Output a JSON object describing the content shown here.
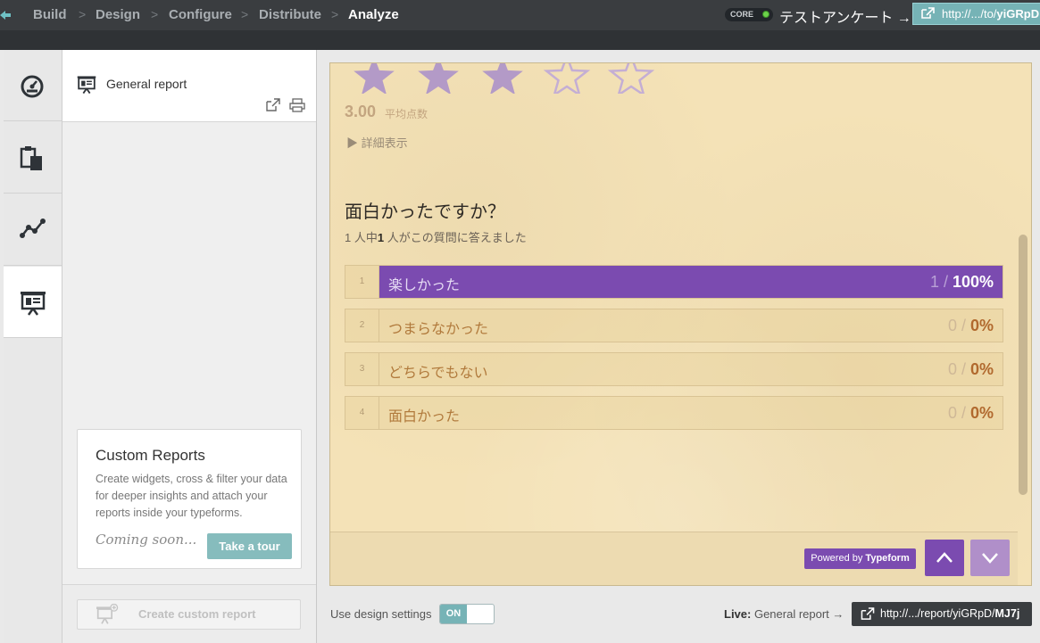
{
  "breadcrumbs": [
    {
      "label": "Build"
    },
    {
      "label": "Design"
    },
    {
      "label": "Configure"
    },
    {
      "label": "Distribute"
    },
    {
      "label": "Analyze",
      "active": true
    }
  ],
  "topbar": {
    "plan_badge": "CORE",
    "form_title": "テストアンケート →",
    "share_url_prefix": "http://.../to/",
    "share_url_code": "yiGRpD"
  },
  "sidebar_icons": [
    {
      "icon": "dashboard-gauge-icon"
    },
    {
      "icon": "clipboard-copy-icon"
    },
    {
      "icon": "line-chart-icon"
    },
    {
      "icon": "presentation-report-icon",
      "active": true
    }
  ],
  "reports_panel": {
    "report_title": "General report",
    "custom_reports": {
      "heading": "Custom Reports",
      "description": "Create widgets, cross & filter your data for deeper insights and attach your reports inside your typeforms.",
      "coming_soon": "Coming soon...",
      "tour_button": "Take a tour"
    },
    "create_button": "Create custom report"
  },
  "preview": {
    "rating": {
      "stars_total": 5,
      "stars_filled": 3,
      "average": "3.00",
      "average_label": "平均点数"
    },
    "details_toggle": "▶ 詳細表示",
    "question": "面白かったですか？",
    "answered": {
      "prefix": "1 人中",
      "count": "1",
      "suffix": " 人がこの質問に答えました"
    },
    "choices": [
      {
        "num": "1",
        "label": "楽しかった",
        "count": "1 / ",
        "percent": "100%",
        "fraction": 1.0
      },
      {
        "num": "2",
        "label": "つまらなかった",
        "count": "0 / ",
        "percent": "0%",
        "fraction": 0
      },
      {
        "num": "3",
        "label": "どちらでもない",
        "count": "0 / ",
        "percent": "0%",
        "fraction": 0
      },
      {
        "num": "4",
        "label": "面白かった",
        "count": "0 / ",
        "percent": "0%",
        "fraction": 0
      }
    ],
    "powered_prefix": "Powered by ",
    "powered_brand": "Typeform"
  },
  "bottom": {
    "use_design_label": "Use design settings",
    "toggle_label": "ON",
    "live_label": "Live:",
    "live_report": "General report →",
    "live_url_prefix": "http://.../report/yiGRpD/",
    "live_url_code": "MJ7j"
  },
  "colors": {
    "accent_purple": "#7b4bb0",
    "teal": "#76b3b6",
    "paper_bg": "#f4e2b7",
    "topbar": "#3a3d40"
  }
}
